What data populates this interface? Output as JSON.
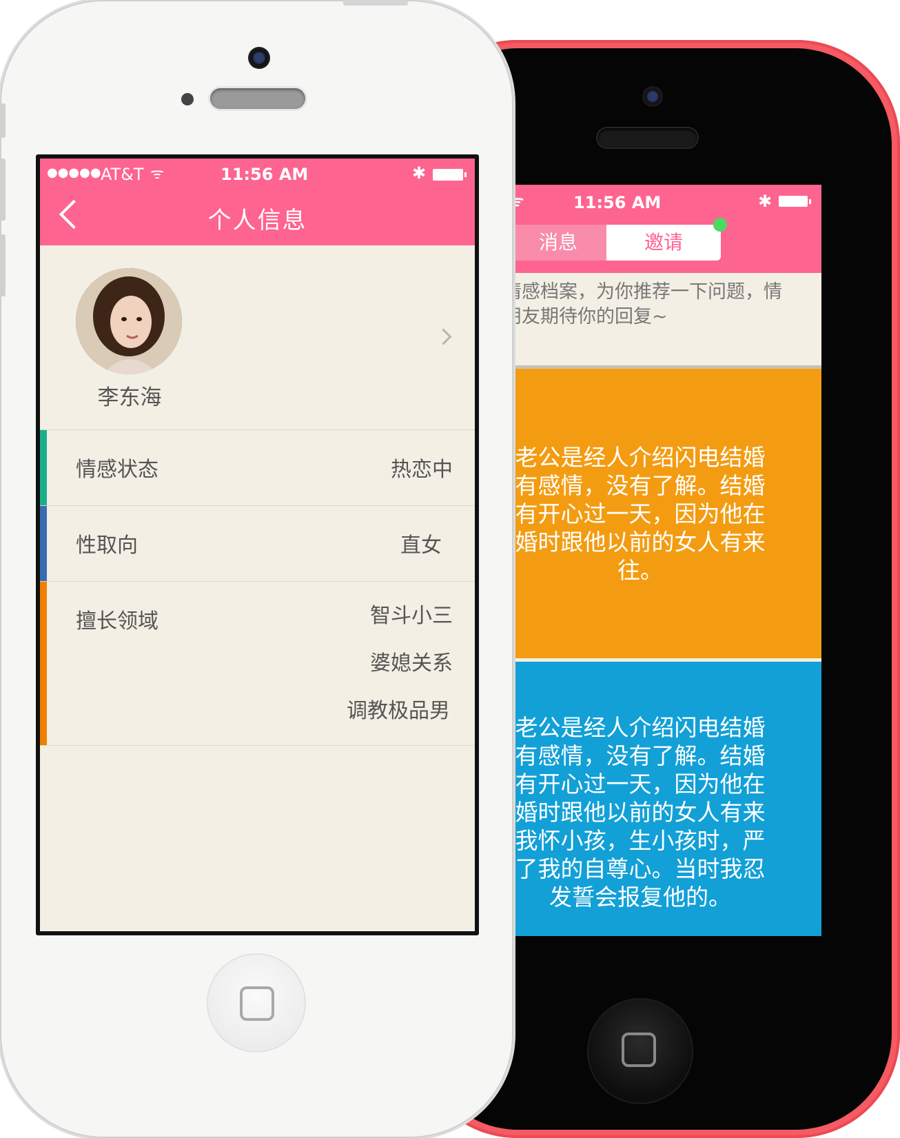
{
  "back_phone": {
    "status": {
      "time": "11:56 AM"
    },
    "tabs": [
      {
        "label": "消息"
      },
      {
        "label": "邀请"
      }
    ],
    "intro_lines": [
      "情感档案，为你推荐一下问题，情",
      "朋友期待你的回复~"
    ],
    "cards": [
      {
        "color": "#f39c12",
        "lines": [
          "老公是经人介绍闪电结婚",
          "有感情，没有了解。结婚",
          "有开心过一天，因为他在",
          "婚时跟他以前的女人有来",
          "往。"
        ]
      },
      {
        "color": "#12a0d7",
        "lines": [
          "老公是经人介绍闪电结婚",
          "有感情，没有了解。结婚",
          "有开心过一天，因为他在",
          "婚时跟他以前的女人有来",
          "我怀小孩，生小孩时，严",
          "了我的自尊心。当时我忍",
          "发誓会报复他的。"
        ]
      }
    ]
  },
  "front_phone": {
    "status": {
      "carrier": "AT&T",
      "time": "11:56 AM",
      "signal": "●●●●●"
    },
    "nav": {
      "title": "个人信息"
    },
    "profile": {
      "name": "李东海"
    },
    "rows": {
      "status": {
        "label": "情感状态",
        "value": "热恋中",
        "accent": "#1aaf8b"
      },
      "orientation": {
        "label": "性取向",
        "value": "直女",
        "accent": "#3a6cb3"
      },
      "expertise": {
        "label": "擅长领域",
        "values": [
          "智斗小三",
          "婆媳关系",
          "调教极品男"
        ],
        "accent": "#ee7f00"
      }
    }
  }
}
